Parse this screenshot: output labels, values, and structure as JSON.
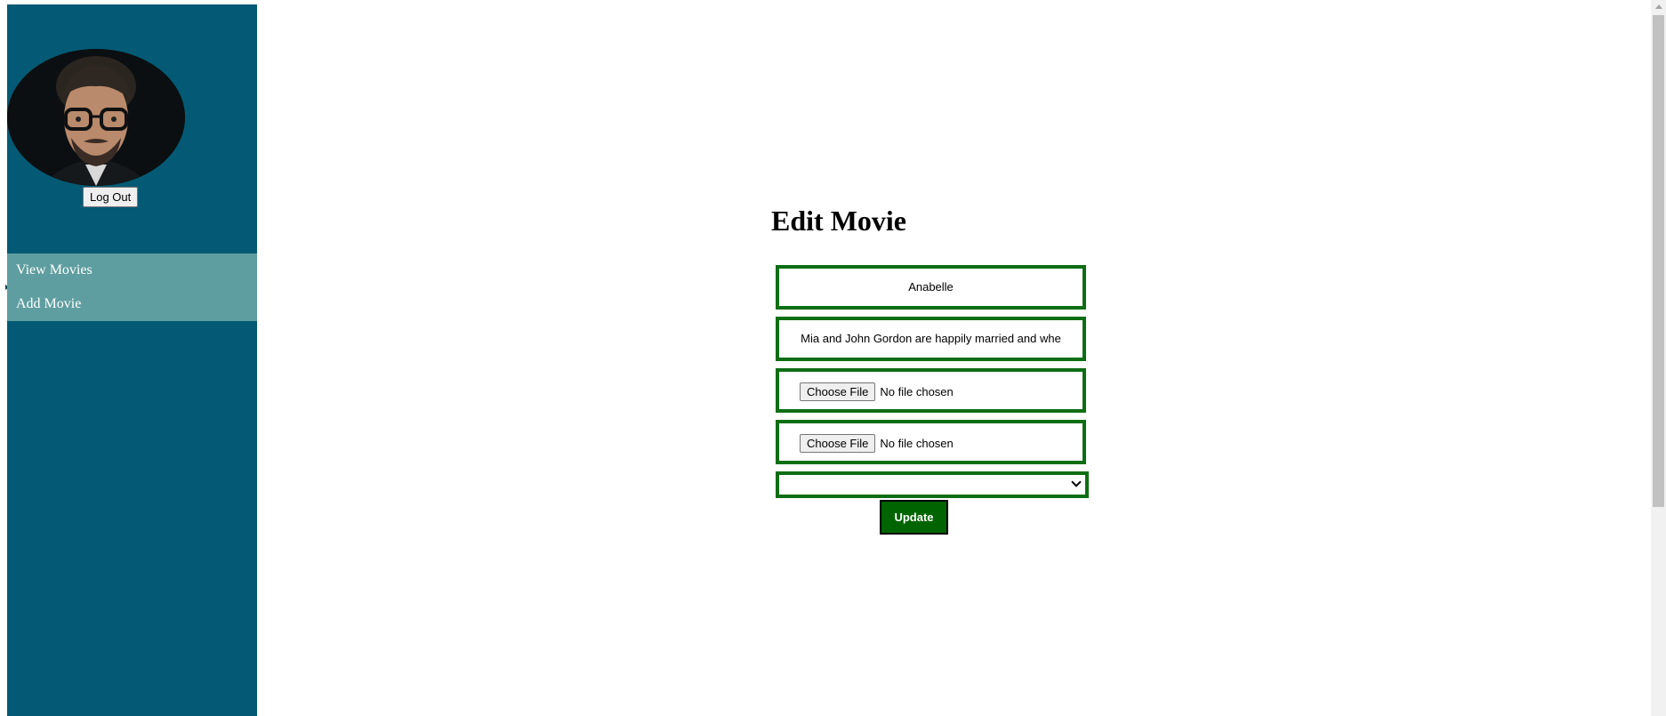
{
  "sidebar": {
    "logout_label": "Log Out",
    "nav_items": [
      {
        "label": "View Movies"
      },
      {
        "label": "Add Movie"
      }
    ],
    "background_color": "#045a74",
    "nav_background_color": "#5f9ea0"
  },
  "main": {
    "title": "Edit Movie",
    "fields": {
      "name_value": "Anabelle",
      "description_value": "Mia and John Gordon are happily married and whe",
      "file1": {
        "button_label": "Choose File",
        "status": "No file chosen"
      },
      "file2": {
        "button_label": "Choose File",
        "status": "No file chosen"
      },
      "select_value": ""
    },
    "update_label": "Update",
    "field_border_color": "#0e6e14",
    "update_button_color": "#006400"
  }
}
